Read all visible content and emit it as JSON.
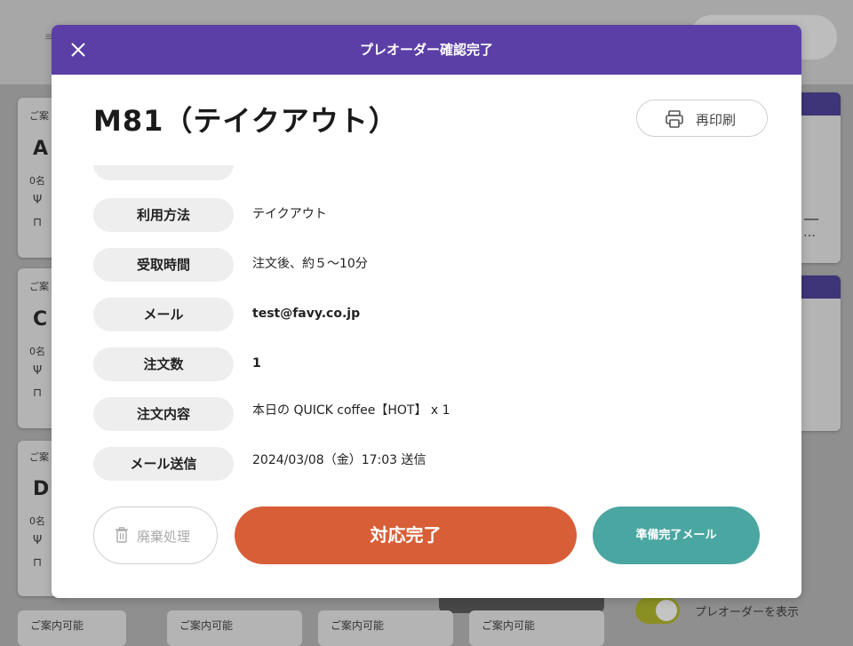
{
  "background": {
    "menu_icon": "≡",
    "cards": [
      {
        "status": "ご案",
        "code": "A",
        "guests": "0名"
      },
      {
        "status": "ご案",
        "code": "C",
        "guests": "0名"
      },
      {
        "status": "ご案",
        "code": "D",
        "guests": "0名"
      }
    ],
    "right_card_dash": "—",
    "right_card_ellipsis": "…",
    "bottom_tiles": [
      "ご案内可能",
      "ご案内可能",
      "ご案内可能",
      "ご案内可能"
    ],
    "toggle_label": "プレオーダーを表示",
    "colors": {
      "card_bar": "#3d3578",
      "toggle_on": "#8a8f23"
    }
  },
  "modal": {
    "title": "プレオーダー確認完了",
    "order_title": "M81（テイクアウト）",
    "reprint_label": "再印刷",
    "rows": [
      {
        "label": "利用方法",
        "value": "テイクアウト"
      },
      {
        "label": "受取時間",
        "value": "注文後、約５〜10分"
      },
      {
        "label": "メール",
        "value": "test@favy.co.jp"
      },
      {
        "label": "注文数",
        "value": "1"
      },
      {
        "label": "注文内容",
        "value": "本日の QUICK coffee【HOT】 x 1"
      },
      {
        "label": "メール送信",
        "value": "2024/03/08（金）17:03 送信"
      }
    ],
    "buttons": {
      "discard": "廃棄処理",
      "complete": "対応完了",
      "ready_mail": "準備完了メール"
    },
    "colors": {
      "header": "#5b3fa6",
      "complete": "#d85e37",
      "ready_mail": "#4aa6a0"
    }
  }
}
